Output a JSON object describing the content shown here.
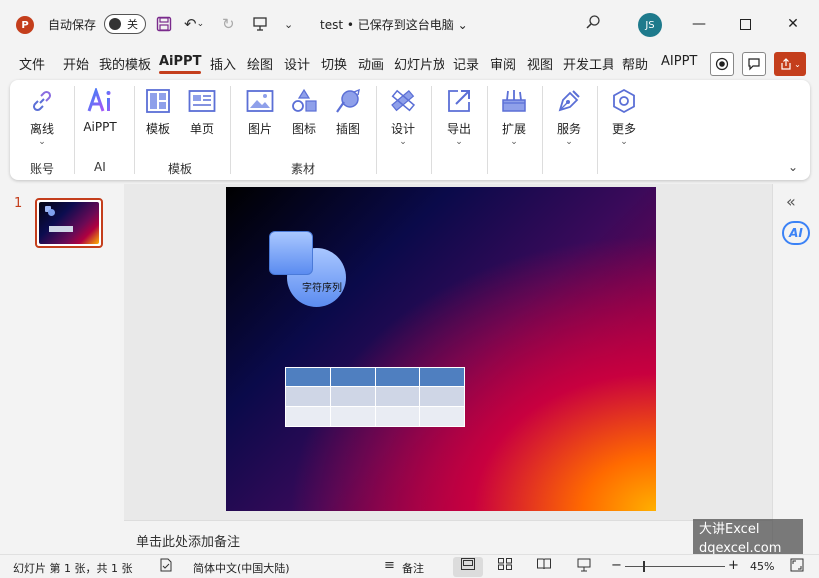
{
  "titlebar": {
    "logo_letter": "P",
    "autosave_label": "自动保存",
    "autosave_state": "关",
    "doc_title": "test • 已保存到这台电脑 ⌄",
    "avatar_initials": "JS"
  },
  "menu": {
    "tabs": [
      "文件",
      "开始",
      "我的模板",
      "AiPPT",
      "插入",
      "绘图",
      "设计",
      "切换",
      "动画",
      "幻灯片放映",
      "记录",
      "审阅",
      "视图",
      "开发工具",
      "帮助",
      "AIPPT"
    ],
    "active": "AiPPT"
  },
  "ribbon": {
    "buttons": {
      "offline": "离线",
      "aippt": "AiPPT",
      "template": "模板",
      "single_page": "单页",
      "picture": "图片",
      "icon": "图标",
      "illustration": "插图",
      "design": "设计",
      "export": "导出",
      "extend": "扩展",
      "service": "服务",
      "more": "更多"
    },
    "groups": {
      "account": "账号",
      "ai": "AI",
      "templates": "模板",
      "material": "素材"
    }
  },
  "thumbnails": {
    "slide_number": "1"
  },
  "slide": {
    "shape_text": "字符序列"
  },
  "notes": {
    "placeholder": "单击此处添加备注"
  },
  "watermark": {
    "line1": "大讲Excel",
    "line2": "dqexcel.com"
  },
  "statusbar": {
    "slide_info": "幻灯片 第 1 张，共 1 张",
    "language": "简体中文(中国大陆)",
    "notes_label": "备注",
    "zoom": "45%",
    "zoom_fraction": 0.45
  },
  "colors": {
    "accent": "#c43e1c",
    "ribbon_icon": "#5b6fd6"
  }
}
